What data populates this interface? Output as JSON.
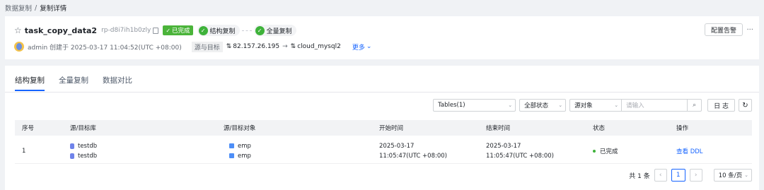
{
  "breadcrumb": {
    "parent": "数据复制",
    "sep": "/",
    "current": "复制详情"
  },
  "task": {
    "name": "task_copy_data2",
    "id": "rp-d8i7ih1b0zly",
    "status_badge": "已完成",
    "steps": [
      "结构复制",
      "全量复制"
    ],
    "creator": "admin 创建于 2025-03-17 11:04:52(UTC +08:00)",
    "source_target_label": "源与目标",
    "source": "82.157.26.195",
    "target": "cloud_mysql2",
    "more_label": "更多"
  },
  "actions": {
    "alarm_button": "配置告警",
    "overflow": "···"
  },
  "tabs": [
    "结构复制",
    "全量复制",
    "数据对比"
  ],
  "filters": {
    "tables": "Tables(1)",
    "status": "全部状态",
    "source_object": "源对象",
    "search_placeholder": "请输入",
    "log_button": "日 志"
  },
  "table": {
    "columns": [
      "序号",
      "源/目标库",
      "源/目标对象",
      "开始时间",
      "结束时间",
      "状态",
      "操作"
    ],
    "rows": [
      {
        "index": "1",
        "db_source": "testdb",
        "db_target": "testdb",
        "obj_source": "emp",
        "obj_target": "emp",
        "start_date": "2025-03-17",
        "start_time": "11:05:47(UTC +08:00)",
        "end_date": "2025-03-17",
        "end_time": "11:05:47(UTC +08:00)",
        "status": "已完成",
        "action": "查看 DDL"
      }
    ]
  },
  "pagination": {
    "total": "共 1 条",
    "current_page": "1",
    "page_size": "10 条/页"
  },
  "colors": {
    "accent": "#1664ff",
    "success": "#3eb23a"
  }
}
